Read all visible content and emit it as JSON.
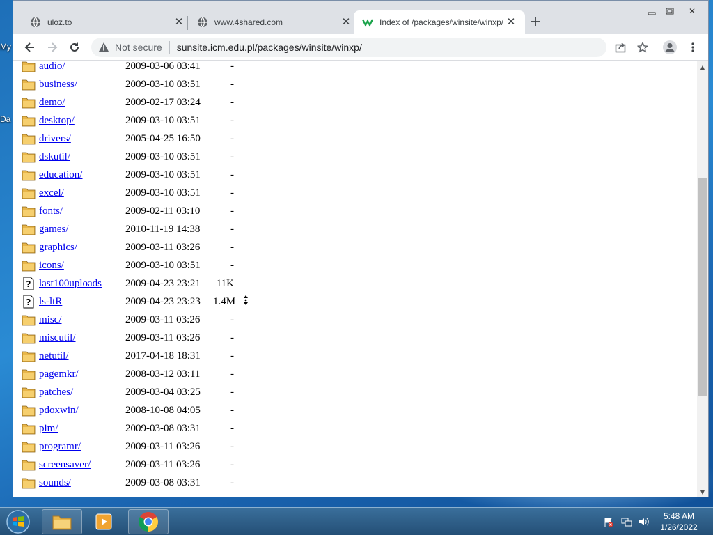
{
  "desktop": {
    "left_labels": [
      "My",
      "Da"
    ]
  },
  "tabs": [
    {
      "title": "uloz.to",
      "active": false
    },
    {
      "title": "www.4shared.com",
      "active": false
    },
    {
      "title": "Index of /packages/winsite/winxp/",
      "active": true
    }
  ],
  "toolbar": {
    "security_text": "Not secure",
    "url": "sunsite.icm.edu.pl/packages/winsite/winxp/"
  },
  "listing": [
    {
      "icon": "folder",
      "name": "audio/",
      "date": "2009-03-06 03:41",
      "size": "-"
    },
    {
      "icon": "folder",
      "name": "business/",
      "date": "2009-03-10 03:51",
      "size": "-"
    },
    {
      "icon": "folder",
      "name": "demo/",
      "date": "2009-02-17 03:24",
      "size": "-"
    },
    {
      "icon": "folder",
      "name": "desktop/",
      "date": "2009-03-10 03:51",
      "size": "-"
    },
    {
      "icon": "folder",
      "name": "drivers/",
      "date": "2005-04-25 16:50",
      "size": "-"
    },
    {
      "icon": "folder",
      "name": "dskutil/",
      "date": "2009-03-10 03:51",
      "size": "-"
    },
    {
      "icon": "folder",
      "name": "education/",
      "date": "2009-03-10 03:51",
      "size": "-"
    },
    {
      "icon": "folder",
      "name": "excel/",
      "date": "2009-03-10 03:51",
      "size": "-"
    },
    {
      "icon": "folder",
      "name": "fonts/",
      "date": "2009-02-11 03:10",
      "size": "-"
    },
    {
      "icon": "folder",
      "name": "games/",
      "date": "2010-11-19 14:38",
      "size": "-"
    },
    {
      "icon": "folder",
      "name": "graphics/",
      "date": "2009-03-11 03:26",
      "size": "-"
    },
    {
      "icon": "folder",
      "name": "icons/",
      "date": "2009-03-10 03:51",
      "size": "-"
    },
    {
      "icon": "unknown",
      "name": "last100uploads",
      "date": "2009-04-23 23:21",
      "size": "11K"
    },
    {
      "icon": "unknown",
      "name": "ls-ltR",
      "date": "2009-04-23 23:23",
      "size": "1.4M"
    },
    {
      "icon": "folder",
      "name": "misc/",
      "date": "2009-03-11 03:26",
      "size": "-"
    },
    {
      "icon": "folder",
      "name": "miscutil/",
      "date": "2009-03-11 03:26",
      "size": "-"
    },
    {
      "icon": "folder",
      "name": "netutil/",
      "date": "2017-04-18 18:31",
      "size": "-"
    },
    {
      "icon": "folder",
      "name": "pagemkr/",
      "date": "2008-03-12 03:11",
      "size": "-"
    },
    {
      "icon": "folder",
      "name": "patches/",
      "date": "2009-03-04 03:25",
      "size": "-"
    },
    {
      "icon": "folder",
      "name": "pdoxwin/",
      "date": "2008-10-08 04:05",
      "size": "-"
    },
    {
      "icon": "folder",
      "name": "pim/",
      "date": "2009-03-08 03:31",
      "size": "-"
    },
    {
      "icon": "folder",
      "name": "programr/",
      "date": "2009-03-11 03:26",
      "size": "-"
    },
    {
      "icon": "folder",
      "name": "screensaver/",
      "date": "2009-03-11 03:26",
      "size": "-"
    },
    {
      "icon": "folder",
      "name": "sounds/",
      "date": "2009-03-08 03:31",
      "size": "-"
    }
  ],
  "taskbar": {
    "clock_time": "5:48 AM",
    "clock_date": "1/26/2022"
  },
  "colors": {
    "link": "#0000ee",
    "folder": "#e8b64a",
    "taskbar": "#2f5f8a"
  }
}
